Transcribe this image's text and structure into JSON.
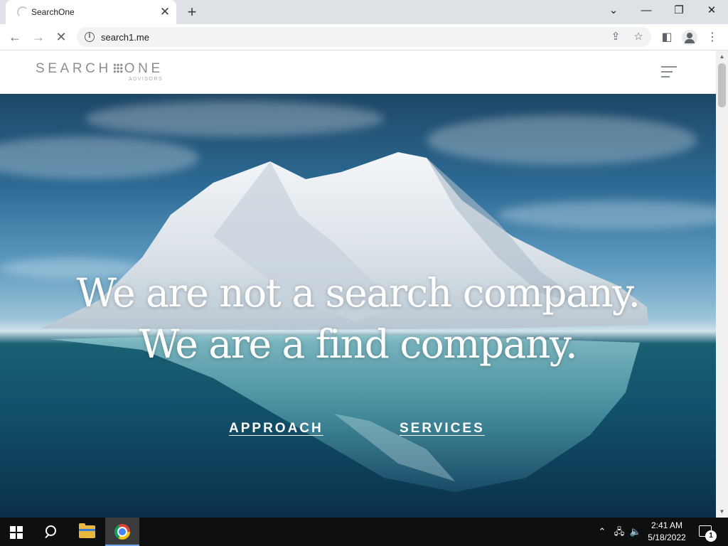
{
  "browser": {
    "tab_title": "SearchOne",
    "url": "search1.me"
  },
  "site": {
    "logo_left": "SEARCH",
    "logo_right": "ONE",
    "logo_sub": "ADVISORS",
    "hero_line1": "We are not a search company.",
    "hero_line2": "We are a find company.",
    "nav_links": [
      "APPROACH",
      "SERVICES"
    ]
  },
  "taskbar": {
    "time": "2:41 AM",
    "date": "5/18/2022",
    "notification_count": "1"
  },
  "colors": {
    "chrome_tabstrip": "#dee1e6",
    "taskbar": "#0e0f11",
    "logo_gray": "#8a8f94",
    "hero_text": "#ffffff"
  },
  "icons": [
    "loading-spinner-icon",
    "close-icon",
    "plus-icon",
    "chevron-down-icon",
    "minimize-icon",
    "restore-icon",
    "window-close-icon",
    "back-arrow-icon",
    "forward-arrow-icon",
    "stop-loading-icon",
    "info-icon",
    "share-icon",
    "star-icon",
    "side-panel-icon",
    "profile-icon",
    "kebab-menu-icon",
    "hamburger-menu-icon",
    "windows-start-icon",
    "search-icon",
    "file-explorer-icon",
    "chrome-icon",
    "chevron-up-icon",
    "network-icon",
    "volume-icon",
    "notification-icon"
  ]
}
